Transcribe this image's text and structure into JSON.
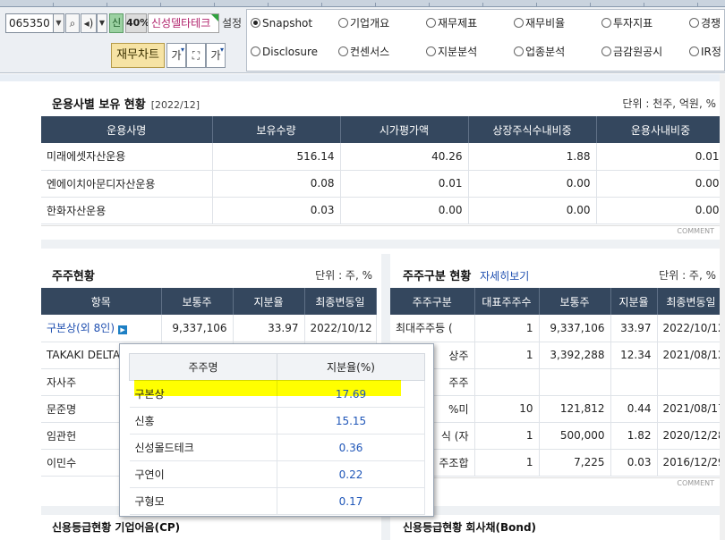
{
  "toolbar": {
    "code": "065350",
    "sin_label": "신",
    "pct_label": "40%",
    "company": "신성델타테크",
    "setting_label": "설정",
    "chart_button": "재무차트",
    "ga_label": "가",
    "ga2_label": "가"
  },
  "radios": [
    {
      "label": "Snapshot",
      "selected": true
    },
    {
      "label": "기업개요",
      "selected": false
    },
    {
      "label": "재무제표",
      "selected": false
    },
    {
      "label": "재무비율",
      "selected": false
    },
    {
      "label": "투자지표",
      "selected": false
    },
    {
      "label": "경쟁",
      "selected": false
    },
    {
      "label": "Disclosure",
      "selected": false
    },
    {
      "label": "컨센서스",
      "selected": false
    },
    {
      "label": "지분분석",
      "selected": false
    },
    {
      "label": "업종분석",
      "selected": false
    },
    {
      "label": "금감원공시",
      "selected": false
    },
    {
      "label": "IR정",
      "selected": false
    }
  ],
  "fund": {
    "title": "운용사별 보유 현황",
    "period": "[2022/12]",
    "unit": "단위 : 천주, 억원, %",
    "headers": [
      "운용사명",
      "보유수량",
      "시가평가액",
      "상장주식수내비중",
      "운용사내비중"
    ],
    "rows": [
      [
        "미래에셋자산운용",
        "516.14",
        "40.26",
        "1.88",
        "0.01"
      ],
      [
        "엔에이치아문디자산운용",
        "0.08",
        "0.01",
        "0.00",
        "0.00"
      ],
      [
        "한화자산운용",
        "0.03",
        "0.00",
        "0.00",
        "0.00"
      ]
    ],
    "more": "COMMENT"
  },
  "holders": {
    "title": "주주현황",
    "unit": "단위 : 주, %",
    "headers": [
      "항목",
      "보통주",
      "지분율",
      "최종변동일"
    ],
    "rows": [
      [
        "구본상(외 8인)",
        "9,337,106",
        "33.97",
        "2022/10/12"
      ],
      [
        "TAKAKI DELTA",
        "",
        "",
        ""
      ],
      [
        "자사주",
        "",
        "",
        ""
      ],
      [
        "문준명",
        "",
        "",
        ""
      ],
      [
        "임관헌",
        "",
        "",
        ""
      ],
      [
        "이민수",
        "",
        "",
        ""
      ]
    ]
  },
  "types": {
    "title": "주주구분 현황",
    "link": "자세히보기",
    "unit": "단위 : 주, %",
    "headers": [
      "주주구분",
      "대표주주수",
      "보통주",
      "지분율",
      "최종변동일"
    ],
    "rows": [
      [
        "최대주주등 (",
        "1",
        "9,337,106",
        "33.97",
        "2022/10/12"
      ],
      [
        "상주",
        "1",
        "3,392,288",
        "12.34",
        "2021/08/12"
      ],
      [
        "주주",
        "",
        "",
        "",
        ""
      ],
      [
        "%미",
        "10",
        "121,812",
        "0.44",
        "2021/08/17"
      ],
      [
        "식 (자",
        "1",
        "500,000",
        "1.82",
        "2020/12/28"
      ],
      [
        "주조합",
        "1",
        "7,225",
        "0.03",
        "2016/12/29"
      ]
    ],
    "more": "COMMENT"
  },
  "popup": {
    "headers": [
      "주주명",
      "지분율(%)"
    ],
    "rows": [
      [
        "구본상",
        "17.69"
      ],
      [
        "신홍",
        "15.15"
      ],
      [
        "신성몰드테크",
        "0.36"
      ],
      [
        "구연이",
        "0.22"
      ],
      [
        "구형모",
        "0.17"
      ]
    ]
  },
  "bottom": {
    "left_title": "신용등급현황 기업어음(CP)",
    "right_title": "신용등급현황 회사채(Bond)"
  }
}
